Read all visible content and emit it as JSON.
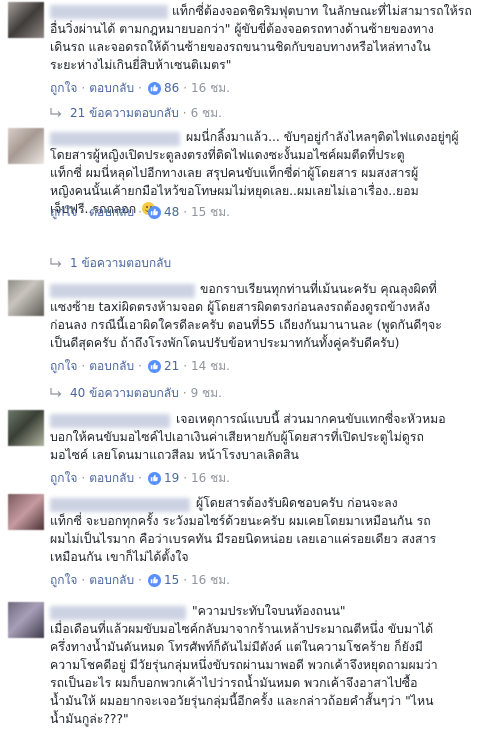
{
  "comments": [
    {
      "lines": [
        "แท็กซี่ต้องจอดชิดริมฟุตบาท ในลักษณะที่ไม่สามารถให้รถ",
        "อื่นวิ่งผ่านได้ ตามกฎหมายบอกว่า\" ผู้ขับขี่ต้องจอดรถทางด้านซ้ายของทาง",
        "เดินรถ และจอดรถให้ด้านซ้ายของรถขนานชิดกับขอบทางหรือไหล่ทางใน",
        "ระยะห่างไม่เกินยี่สิบห้าเซนติเมตร\""
      ],
      "like": "ถูกใจ",
      "reply": "ตอบกลับ",
      "likes": "86",
      "time": "16 ชม.",
      "replies_label": "21 ข้อความตอบกลับ",
      "replies_time": "6 ชม."
    },
    {
      "lines": [
        "ผมนี่กลิ้งมาแล้ว... ขับๆอยู่กำลังไหลๆติดไฟแดงอยู่ๆผู้",
        "โดยสารผู้หญิงเปิดประตูลงตรงที่ติดไฟแดงซะงั้นมอไซค์ผมตีดที่ประตู",
        "แท็กซี่ ผมนี่หลุดไปอีกทางเลย สรุปคนขับแท็กซี่ด่าผู้โดยสาร ผมสงสารผู้",
        "หญิงคนนั้นเค้ายกมือไหว้ขอโทษผมไม่หยุดเลย..ผมเลยไม่เอาเรื่อง..ยอม",
        "เจ็บฟรี..รถถลอก"
      ],
      "like": "ถูกใจ",
      "reply": "ตอบกลับ",
      "likes": "48",
      "time": "15 ชม.",
      "replies_label": "1 ข้อความตอบกลับ",
      "replies_time": ""
    },
    {
      "lines": [
        "ขอกราบเรียนทุกท่านที่เม้นนะครับ คุณลุงผิดที่",
        "แซงซ้าย taxiผิดตรงห้ามจอด ผู้โดยสารผิดตรงก่อนลงรถต้องดูรถข้างหลัง",
        "ก่อนลง กรณีนี้เอาผิดใครดีละครับ ตอนที่55 เถียงกันมานานละ (พูดกันดีๆจะ",
        "เป็นดีสุดครับ ถ้าถึงโรงพักโดนปรับข้อหาประมาทกันทั้งคู่ครับดีครับ)"
      ],
      "like": "ถูกใจ",
      "reply": "ตอบกลับ",
      "likes": "21",
      "time": "14 ชม.",
      "replies_label": "40 ข้อความตอบกลับ",
      "replies_time": "9 ชม."
    },
    {
      "lines": [
        "เจอเหตุการณ์แบบนี้ ส่วนมากคนขับแทกซี่จะหัวหมอ",
        "บอกให้คนขับมอไซค์ไปเอาเงินค่าเสียหายกับผู้โดยสารที่เปิดประตูไม่ดูรถ",
        "มอไซค์ เลยโดนมาแถวสีลม หน้าโรงบาลเลิดสิน"
      ],
      "like": "ถูกใจ",
      "reply": "ตอบกลับ",
      "likes": "19",
      "time": "16 ชม."
    },
    {
      "lines": [
        "ผู้โดยสารต้องรับผิดชอบครับ ก่อนจะลง",
        "แท็กซี่ จะบอกทุกครั้ง ระวังมอไซร์ด้วยนะครับ ผมเคยโดยมาเหมือนกัน รถ",
        "ผมไม่เป็นไรมาก คือว่าเบรคทัน มีรอยนิดหน่อย เลยเอาแค่รอยเดียว สงสาร",
        "เหมือนกัน เขาก็ไม่ได้ตั้งใจ"
      ],
      "like": "ถูกใจ",
      "reply": "ตอบกลับ",
      "likes": "15",
      "time": "16 ชม."
    },
    {
      "lines": [
        "\"ความประทับใจบนท้องถนน\"",
        "เมื่อเดือนที่แล้วผมขับมอไซค์กลับมาจากร้านเหล้าประมาณตีหนึ่ง ขับมาได้",
        "ครึ่งทางน้ำมันดันหมด โทรศัพท์ก็ดันไม่มีตังค์ แต่ในความโชคร้าย ก็ยังมี",
        "ความโชคดีอยู่ มีวัยรุ่นกลุ่มหนึ่งขับรถผ่านมาพอดี พวกเค้าจึงหยุดถามผมว่า",
        "รถเป็นอะไร ผมก็บอกพวกเค้าไปว่ารถน้ำมันหมด พวกเค้าจึงอาสาไปซื้อ",
        "น้ำมันให้ ผมอยากจะเจอวัยรุ่นกลุ่มนี้อีกครั้ง และกล่าวถ้อยคำสั้นๆว่า \"ไหน",
        "น้ำมันกูล่ะ???\""
      ]
    }
  ],
  "colors": {
    "link": "#4b67a1",
    "meta": "#90949c",
    "like_icon": "#5890ff",
    "text": "#1d2129"
  },
  "icons": {
    "like": "thumbs-up-icon",
    "reply_arrow": "reply-arrow-icon",
    "emoji": "smile-emoji-icon"
  }
}
